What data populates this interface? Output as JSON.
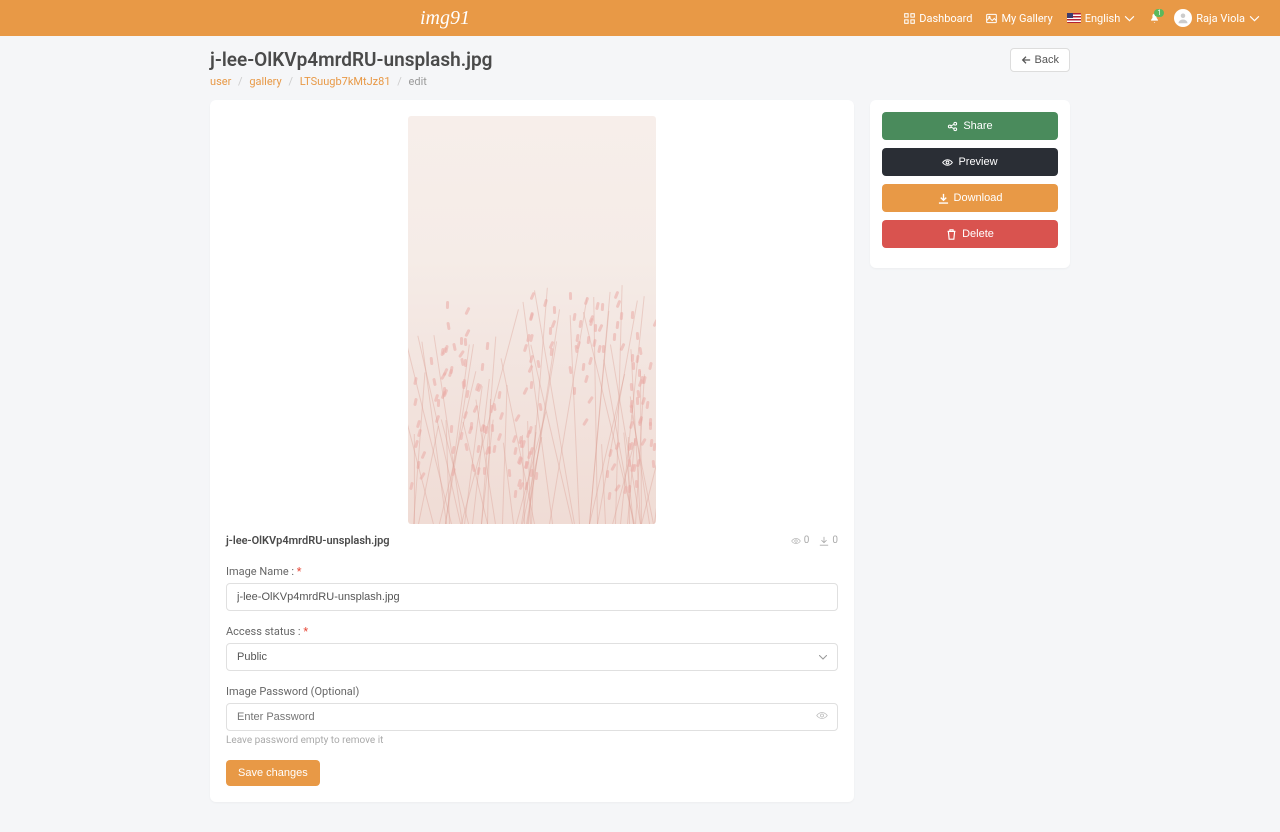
{
  "brand": "img91",
  "nav": {
    "dashboard": "Dashboard",
    "gallery": "My Gallery",
    "language": "English",
    "user": "Raja Viola",
    "notif_count": "1"
  },
  "page_title": "j-lee-OlKVp4mrdRU-unsplash.jpg",
  "breadcrumb": {
    "user": "user",
    "gallery": "gallery",
    "id": "LTSuugb7kMtJz81",
    "edit": "edit"
  },
  "back_label": "Back",
  "image": {
    "display_name": "j-lee-OlKVp4mrdRU-unsplash.jpg",
    "views": "0",
    "downloads": "0"
  },
  "form": {
    "name_label": "Image Name :",
    "name_value": "j-lee-OlKVp4mrdRU-unsplash.jpg",
    "access_label": "Access status :",
    "access_value": "Public",
    "password_label": "Image Password (Optional)",
    "password_placeholder": "Enter Password",
    "password_hint": "Leave password empty to remove it",
    "save_label": "Save changes"
  },
  "actions": {
    "share": "Share",
    "preview": "Preview",
    "download": "Download",
    "delete": "Delete"
  }
}
